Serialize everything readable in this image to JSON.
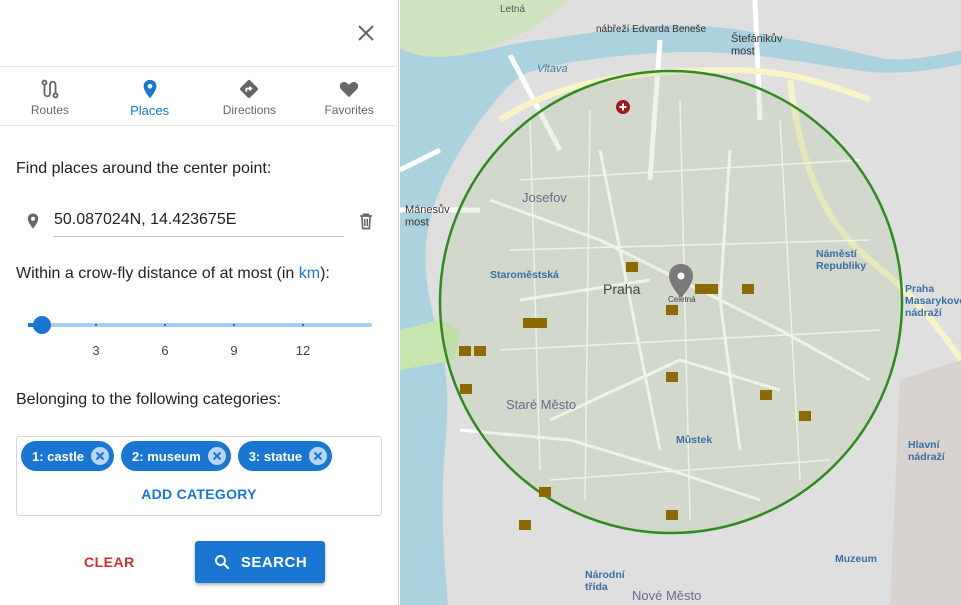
{
  "tabs": [
    {
      "label": "Routes",
      "icon": "route-icon"
    },
    {
      "label": "Places",
      "icon": "place-icon"
    },
    {
      "label": "Directions",
      "icon": "directions-icon"
    },
    {
      "label": "Favorites",
      "icon": "heart-icon"
    }
  ],
  "active_tab": "Places",
  "find_label": "Find places around the center point:",
  "center_value": "50.087024N, 14.423675E",
  "distance": {
    "label_prefix": "Within a crow-fly distance of at most (in ",
    "unit": "km",
    "label_suffix": "):",
    "value": 0,
    "ticks": [
      "3",
      "6",
      "9",
      "12"
    ]
  },
  "categories_label": "Belonging to the following categories:",
  "categories": [
    "1: castle",
    "2: museum",
    "3: statue"
  ],
  "add_category_label": "ADD CATEGORY",
  "clear_label": "CLEAR",
  "search_label": "SEARCH",
  "map": {
    "labels": {
      "praha": "Praha",
      "josefov": "Josefov",
      "stare_mesto": "Staré Město",
      "staromestska": "Staroměstská",
      "namesti_republiky": "Náměstí\nRepubliky",
      "mustek": "Můstek",
      "praha_masarykovo": "Praha\nMasarykovo\nnádraží",
      "hlavni_nadrazi": "Hlavní\nnádraží",
      "vltava": "Vltava",
      "manesuv_most": "Mánesův\nmost",
      "stefanikuv_most": "Štefánikův\nmost",
      "muzeum": "Muzeum",
      "narodni_trida": "Národní\ntřída",
      "nove_mesto": "Nové Město",
      "letna": "Letná",
      "celetna": "Celetná",
      "nabrezi": "nábřeží Edvarda Beneše"
    },
    "colors": {
      "circle": "#2e8b20",
      "water": "#aad3df",
      "urban": "#e0dfdf",
      "park": "#c8e6b0",
      "marker": "#7a7a7a",
      "poi": "#8b6a00"
    }
  }
}
